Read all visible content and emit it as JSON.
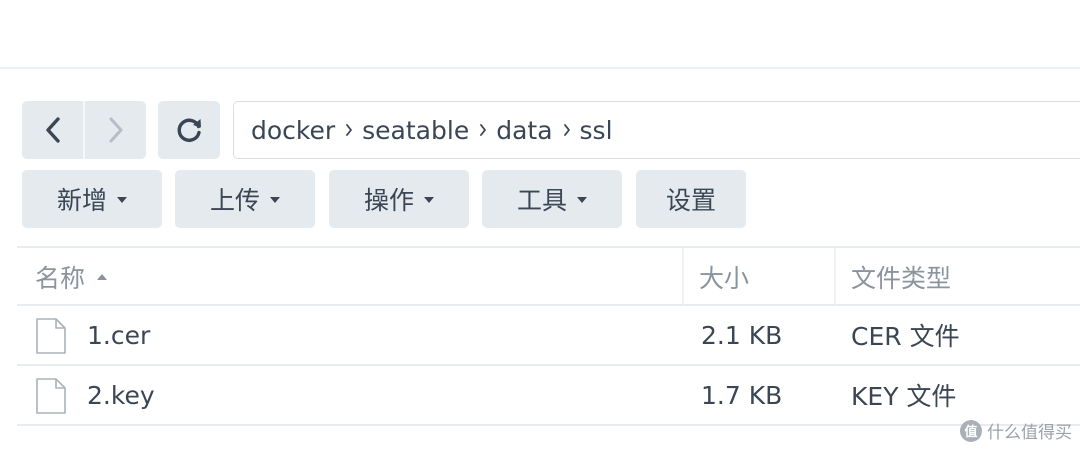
{
  "breadcrumb": [
    "docker",
    "seatable",
    "data",
    "ssl"
  ],
  "toolbar": {
    "create": "新增",
    "upload": "上传",
    "action": "操作",
    "tools": "工具",
    "settings": "设置"
  },
  "table": {
    "columns": {
      "name": "名称",
      "size": "大小",
      "type": "文件类型"
    },
    "rows": [
      {
        "name": "1.cer",
        "size": "2.1 KB",
        "type": "CER 文件"
      },
      {
        "name": "2.key",
        "size": "1.7 KB",
        "type": "KEY 文件"
      }
    ]
  },
  "watermark": {
    "logo": "值",
    "text": "什么值得买"
  },
  "icons": {
    "back": "chevron-left-icon",
    "forward": "chevron-right-icon",
    "refresh": "refresh-icon",
    "breadcrumb_separator": "chevron-right-icon",
    "file": "file-icon",
    "sort": "sort-ascending-icon",
    "dropdown": "caret-down-icon"
  },
  "colors": {
    "button_bg": "#e5eaef",
    "text": "#3a4654",
    "header_text": "#8a949e",
    "disabled_icon": "#b5bdc5",
    "border": "#e8ecef"
  }
}
